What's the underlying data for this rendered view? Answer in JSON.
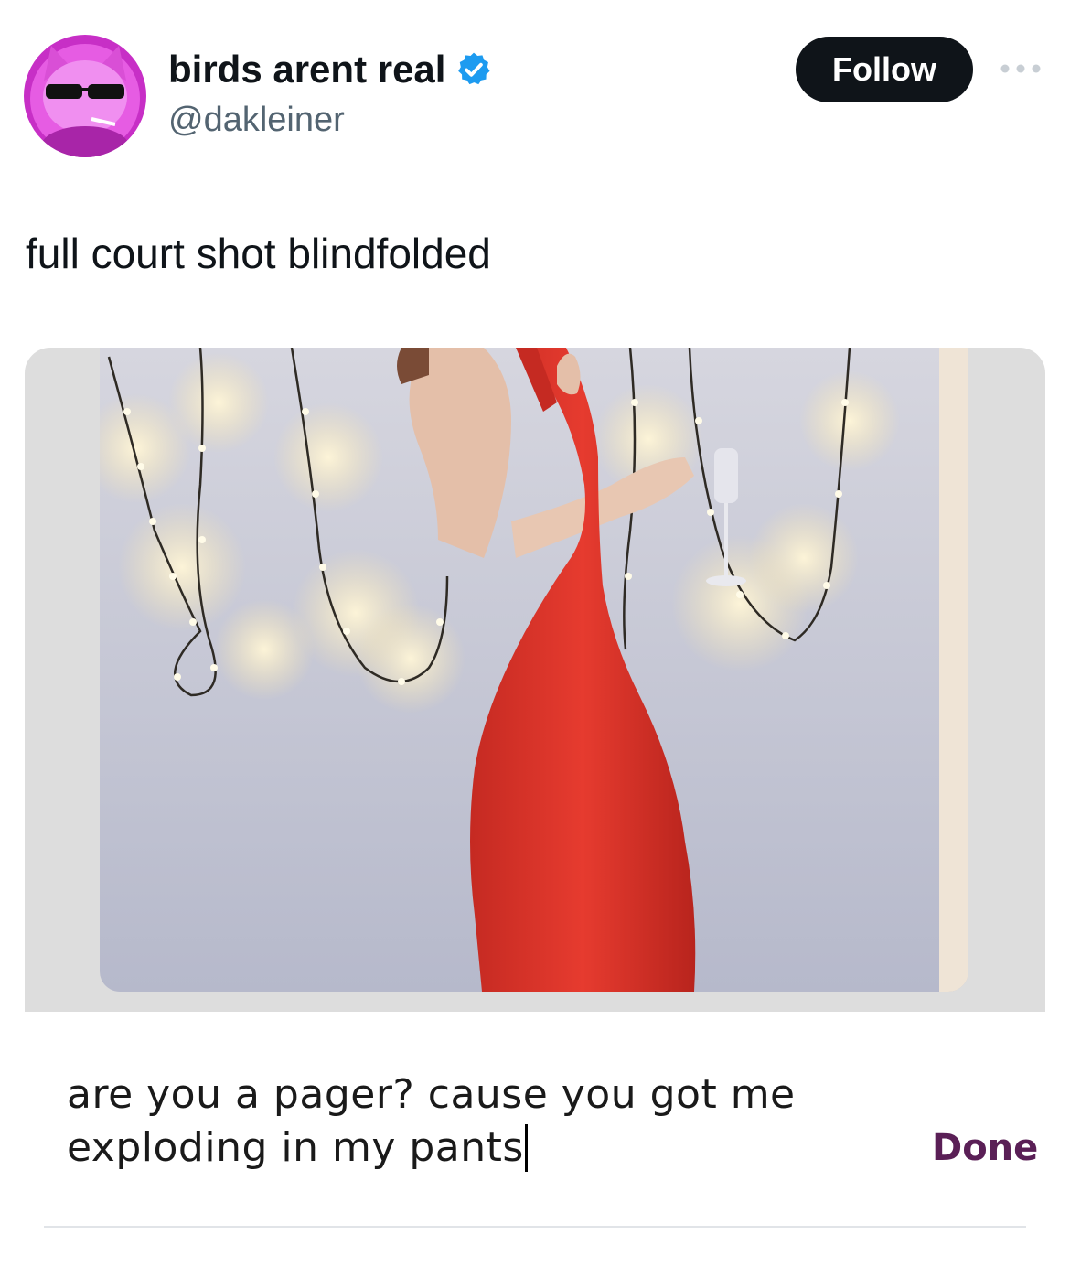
{
  "author": {
    "display_name": "birds arent real",
    "handle": "@dakleiner",
    "verified": true,
    "avatar_icon": "cat-with-sunglasses-avatar"
  },
  "actions": {
    "follow_label": "Follow",
    "more_icon": "more-dots-icon"
  },
  "tweet": {
    "text": "full court shot blindfolded"
  },
  "media": {
    "description_icon": "photo-red-dress-string-lights",
    "caption_line1": "are you a pager? cause you got me",
    "caption_line2": "exploding in my pants",
    "done_label": "Done"
  },
  "colors": {
    "follow_bg": "#0f1419",
    "verified_blue": "#1d9bf0",
    "done_purple": "#5a1f56",
    "dress_red": "#d9362c",
    "avatar_magenta": "#d63bd8"
  }
}
